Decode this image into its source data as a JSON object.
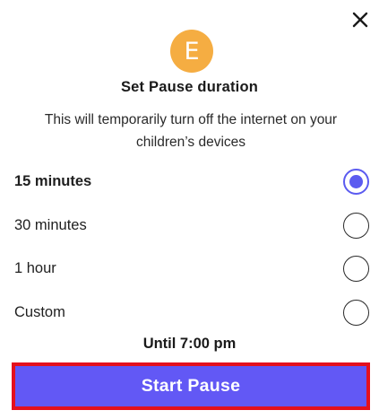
{
  "dialog": {
    "close_icon": "close-icon",
    "avatar_letter": "E",
    "title": "Set Pause duration",
    "subtitle": "This will temporarily turn off the internet on your children’s devices",
    "options": [
      {
        "label": "15 minutes",
        "selected": true
      },
      {
        "label": "30 minutes",
        "selected": false
      },
      {
        "label": "1 hour",
        "selected": false
      },
      {
        "label": "Custom",
        "selected": false
      }
    ],
    "until_text": "Until 7:00 pm",
    "start_button_label": "Start Pause"
  },
  "colors": {
    "accent": "#6258f5",
    "avatar": "#f5ad42",
    "highlight_border": "#e4101e"
  }
}
